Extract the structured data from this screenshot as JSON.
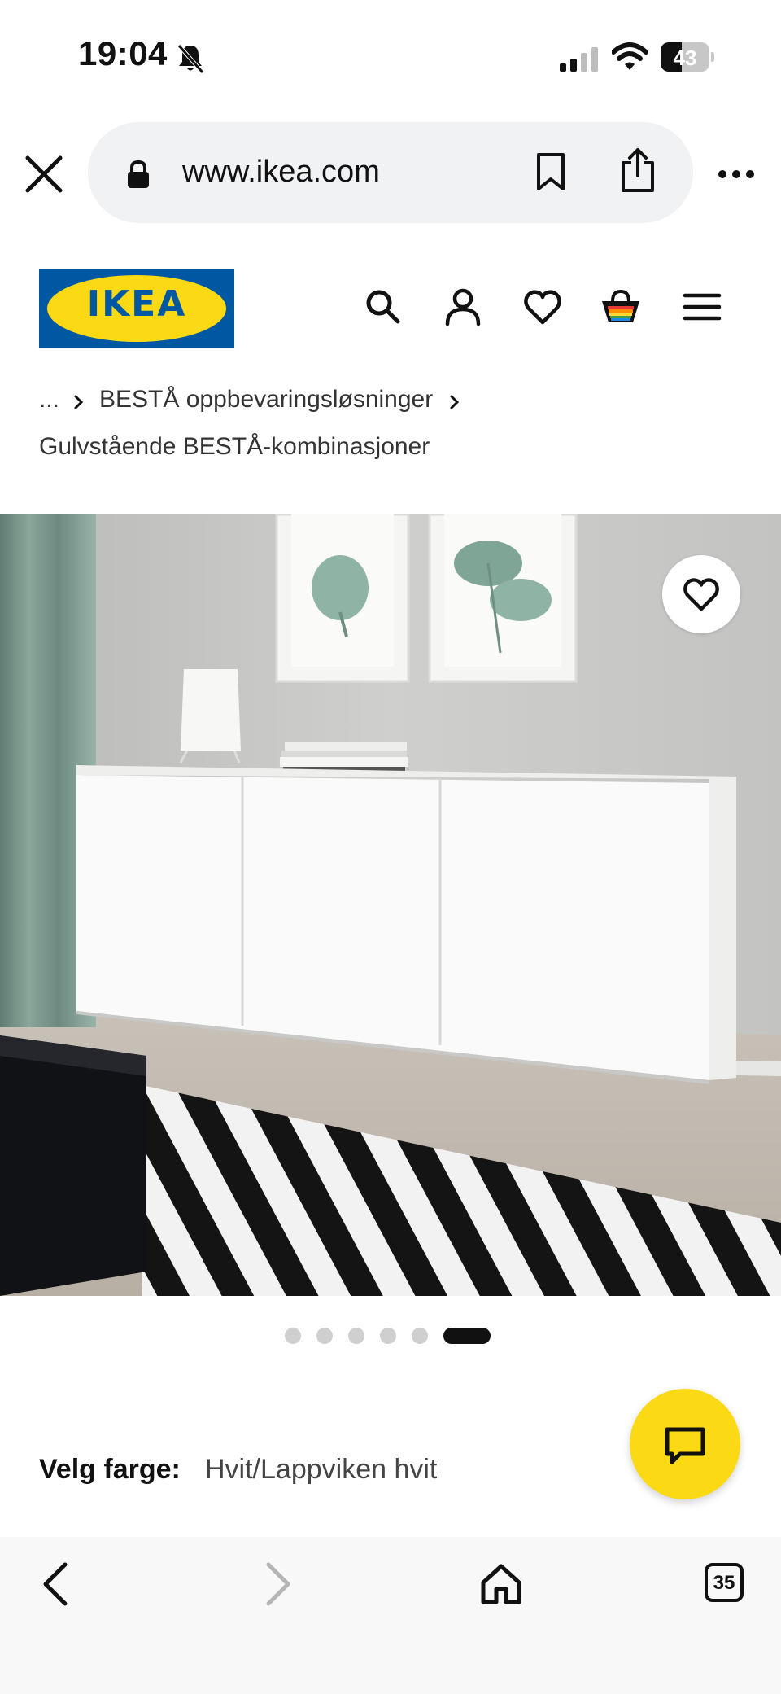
{
  "status": {
    "time": "19:04",
    "battery": "43",
    "battery_level": 0.43
  },
  "browser": {
    "url": "www.ikea.com",
    "tabs_count": "35"
  },
  "header": {
    "logo_text": "IKEA"
  },
  "breadcrumb": {
    "ellipsis": "...",
    "category": "BESTÅ oppbevaringsløsninger",
    "current": "Gulvstående BESTÅ-kombinasjoner"
  },
  "gallery": {
    "slides": 6,
    "active": 6
  },
  "product": {
    "color_label": "Velg farge:",
    "color_value": "Hvit/Lappviken hvit"
  },
  "colors": {
    "ikea_blue": "#0058a3",
    "ikea_yellow": "#fbd914"
  }
}
